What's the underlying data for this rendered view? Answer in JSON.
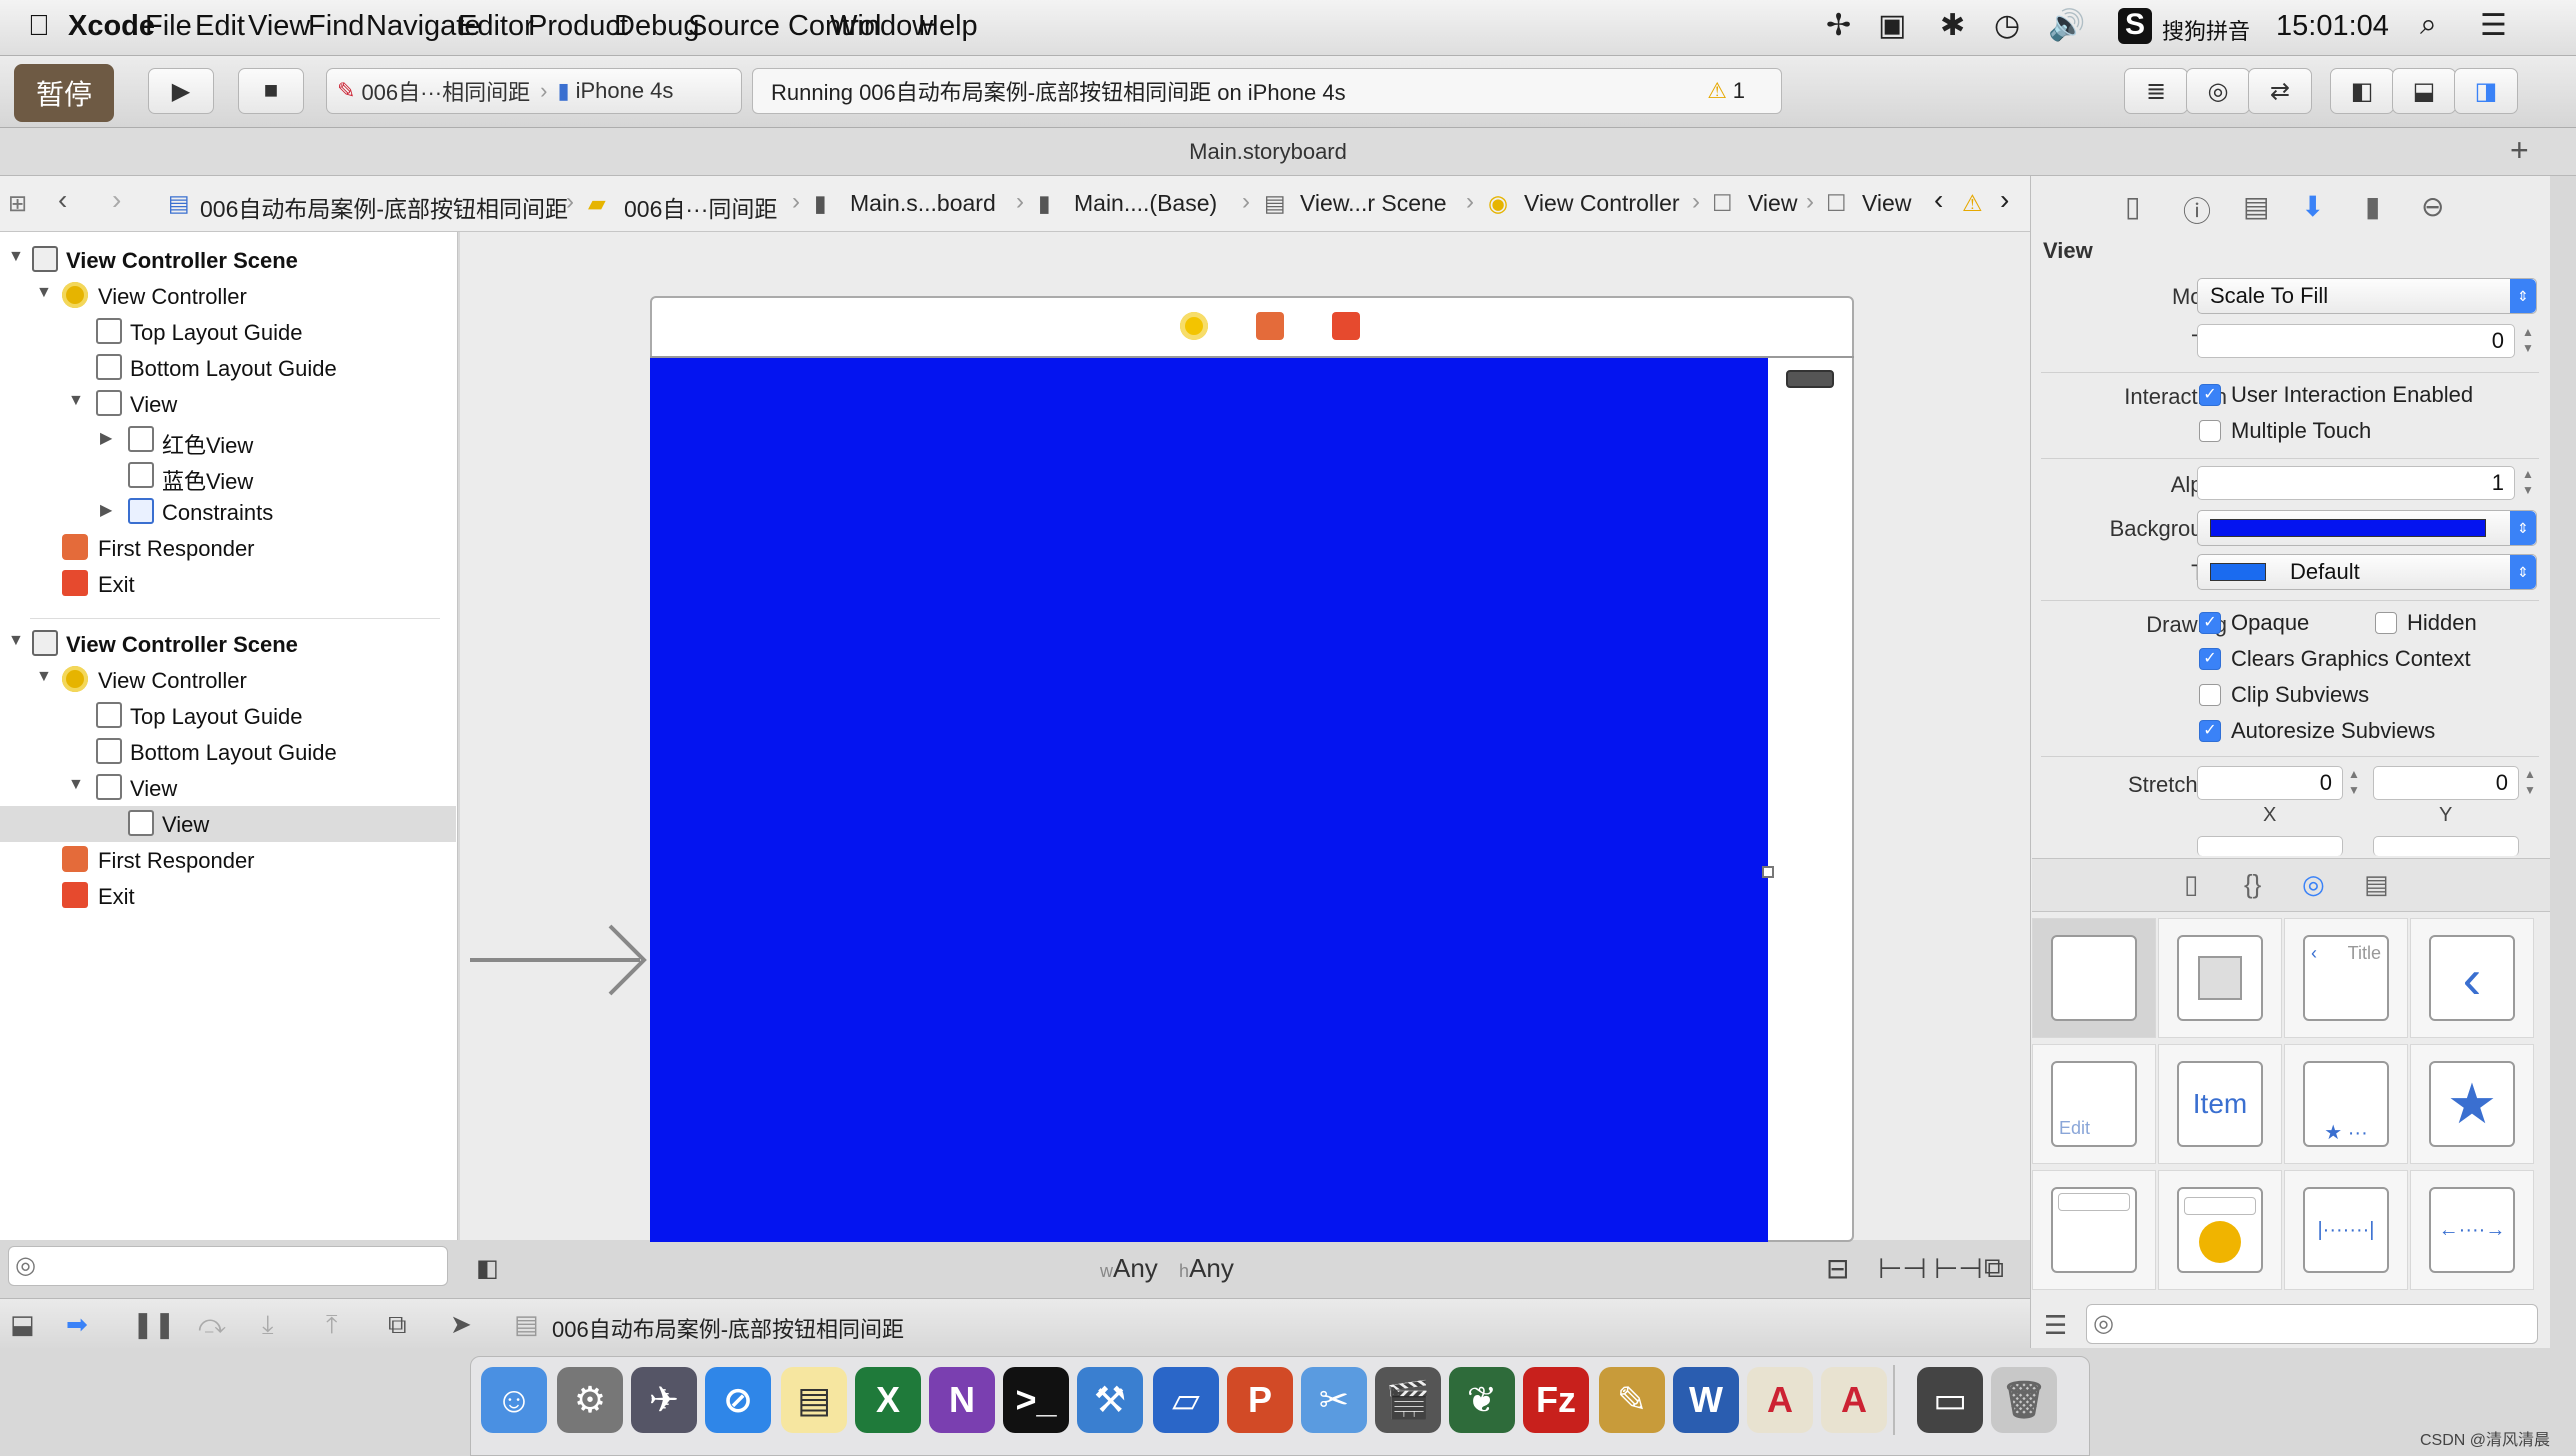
{
  "menubar": {
    "apple": "",
    "items": [
      "Xcode",
      "File",
      "Edit",
      "View",
      "Find",
      "Navigate",
      "Editor",
      "Product",
      "Debug",
      "Source Control",
      "Window",
      "Help"
    ],
    "input_method": "搜狗拼音",
    "clock": "15:01:04"
  },
  "toolbar": {
    "pause_label": "暂停",
    "scheme": "006自···相同间距",
    "device": "iPhone 4s",
    "status": "Running 006自动布局案例-底部按钮相同间距 on iPhone 4s",
    "warning_count": "1"
  },
  "tab": {
    "title": "Main.storyboard"
  },
  "jumpbar": {
    "items": [
      "006自动布局案例-底部按钮相同间距",
      "006自···同间距",
      "Main.s...board",
      "Main....(Base)",
      "View...r Scene",
      "View Controller",
      "View",
      "View"
    ]
  },
  "navigator": {
    "rows": [
      {
        "label": "View Controller Scene",
        "icon": "scene-icon",
        "bold": true
      },
      {
        "label": "View Controller",
        "icon": "view-controller-icon"
      },
      {
        "label": "Top Layout Guide",
        "icon": "layout-guide-icon"
      },
      {
        "label": "Bottom Layout Guide",
        "icon": "layout-guide-icon"
      },
      {
        "label": "View",
        "icon": "view-icon"
      },
      {
        "label": "红色View",
        "icon": "view-icon"
      },
      {
        "label": "蓝色View",
        "icon": "view-icon"
      },
      {
        "label": "Constraints",
        "icon": "constraints-icon"
      },
      {
        "label": "First Responder",
        "icon": "first-responder-icon"
      },
      {
        "label": "Exit",
        "icon": "exit-icon"
      },
      {
        "label": "View Controller Scene",
        "icon": "scene-icon",
        "bold": true
      },
      {
        "label": "View Controller",
        "icon": "view-controller-icon"
      },
      {
        "label": "Top Layout Guide",
        "icon": "layout-guide-icon"
      },
      {
        "label": "Bottom Layout Guide",
        "icon": "layout-guide-icon"
      },
      {
        "label": "View",
        "icon": "view-icon"
      },
      {
        "label": "View",
        "icon": "view-icon",
        "selected": true
      },
      {
        "label": "First Responder",
        "icon": "first-responder-icon"
      },
      {
        "label": "Exit",
        "icon": "exit-icon"
      }
    ]
  },
  "canvas": {
    "size_w_prefix": "w",
    "size_w": "Any",
    "size_h_prefix": "h",
    "size_h": "Any",
    "view_color": "#0414f0"
  },
  "debugbar": {
    "path": "006自动布局案例-底部按钮相同间距"
  },
  "inspector": {
    "section": "View",
    "mode_label": "Mode",
    "mode_value": "Scale To Fill",
    "tag_label": "Tag",
    "tag_value": "0",
    "interaction_label": "Interaction",
    "user_interaction": "User Interaction Enabled",
    "multiple_touch": "Multiple Touch",
    "alpha_label": "Alpha",
    "alpha_value": "1",
    "background_label": "Background",
    "tint_label": "Tint",
    "tint_value": "Default",
    "drawing_label": "Drawing",
    "opaque": "Opaque",
    "hidden": "Hidden",
    "clears": "Clears Graphics Context",
    "clip": "Clip Subviews",
    "autoresize": "Autoresize Subviews",
    "stretching_label": "Stretching",
    "stretch_x": "0",
    "stretch_y": "0",
    "x_label": "X",
    "y_label": "Y"
  },
  "library": {
    "title_label": "Title",
    "item_label": "Item",
    "edit_label": "Edit"
  },
  "watermark": "CSDN @清风清晨"
}
